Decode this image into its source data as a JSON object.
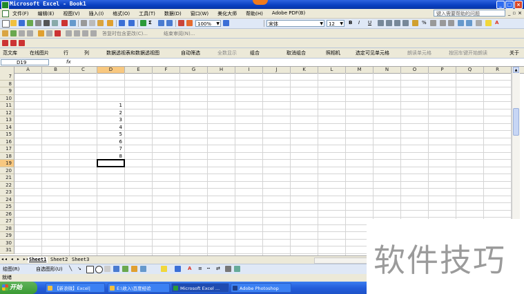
{
  "window": {
    "title": "Microsoft Excel - Book1",
    "min": "_",
    "max": "□",
    "close": "×"
  },
  "menu": {
    "items": [
      "文件(F)",
      "编辑(E)",
      "视图(V)",
      "插入(I)",
      "格式(O)",
      "工具(T)",
      "数据(D)",
      "窗口(W)",
      "美化大师",
      "帮助(H)",
      "Adobe PDF(B)"
    ],
    "help_placeholder": "键入需要帮助的问题",
    "doc_min": "_",
    "doc_restore": "▫",
    "doc_close": "×"
  },
  "toolbar": {
    "zoom": "100%",
    "font": "宋体",
    "size": "12",
    "bold": "B",
    "italic": "I",
    "underline": "U",
    "reply_text": "答复时包含更改(C)...",
    "end_review": "结束审阅(N)..."
  },
  "addin_toolbar": {
    "items": [
      "范文库",
      "在线图片",
      "行",
      "列",
      "数据透视表和数据透视图",
      "自动筛选",
      "全数显示",
      "组合",
      "取消组合",
      "照相机",
      "选定可见单元格",
      "朗读单元格",
      "按回车键开始朗读",
      "关于"
    ]
  },
  "formula": {
    "name_box": "D19",
    "fx": "fx",
    "content": ""
  },
  "columns": [
    "A",
    "B",
    "C",
    "D",
    "E",
    "F",
    "G",
    "H",
    "I",
    "J",
    "K",
    "L",
    "M",
    "N",
    "O",
    "P",
    "Q",
    "R"
  ],
  "selected_column": "D",
  "rows": [
    "7",
    "8",
    "9",
    "10",
    "11",
    "12",
    "13",
    "14",
    "15",
    "16",
    "17",
    "18",
    "19",
    "20",
    "21",
    "22",
    "23",
    "24",
    "25",
    "26",
    "27",
    "28",
    "29",
    "30",
    "31"
  ],
  "selected_row": "19",
  "cells": [
    {
      "row": "11",
      "col": "D",
      "value": "1"
    },
    {
      "row": "12",
      "col": "D",
      "value": "2"
    },
    {
      "row": "13",
      "col": "D",
      "value": "3"
    },
    {
      "row": "14",
      "col": "D",
      "value": "4"
    },
    {
      "row": "15",
      "col": "D",
      "value": "5"
    },
    {
      "row": "16",
      "col": "D",
      "value": "6"
    },
    {
      "row": "17",
      "col": "D",
      "value": "7"
    },
    {
      "row": "18",
      "col": "D",
      "value": "8"
    }
  ],
  "sheets": {
    "nav": "◂◂ ◂ ▸ ▸▸",
    "tabs": [
      "Sheet1",
      "Sheet2",
      "Sheet3"
    ],
    "active": "Sheet1"
  },
  "drawing": {
    "draw_label": "绘图(R)",
    "autoshapes_label": "自选图形(U)"
  },
  "status": {
    "text": "就绪"
  },
  "taskbar": {
    "start": "开始",
    "items": [
      "【新浪微】Excel|",
      "E:\\收入\\百度经验",
      "Microsoft Excel ...",
      "Adobe Photoshop"
    ]
  },
  "watermark": {
    "text": "软件技巧"
  }
}
